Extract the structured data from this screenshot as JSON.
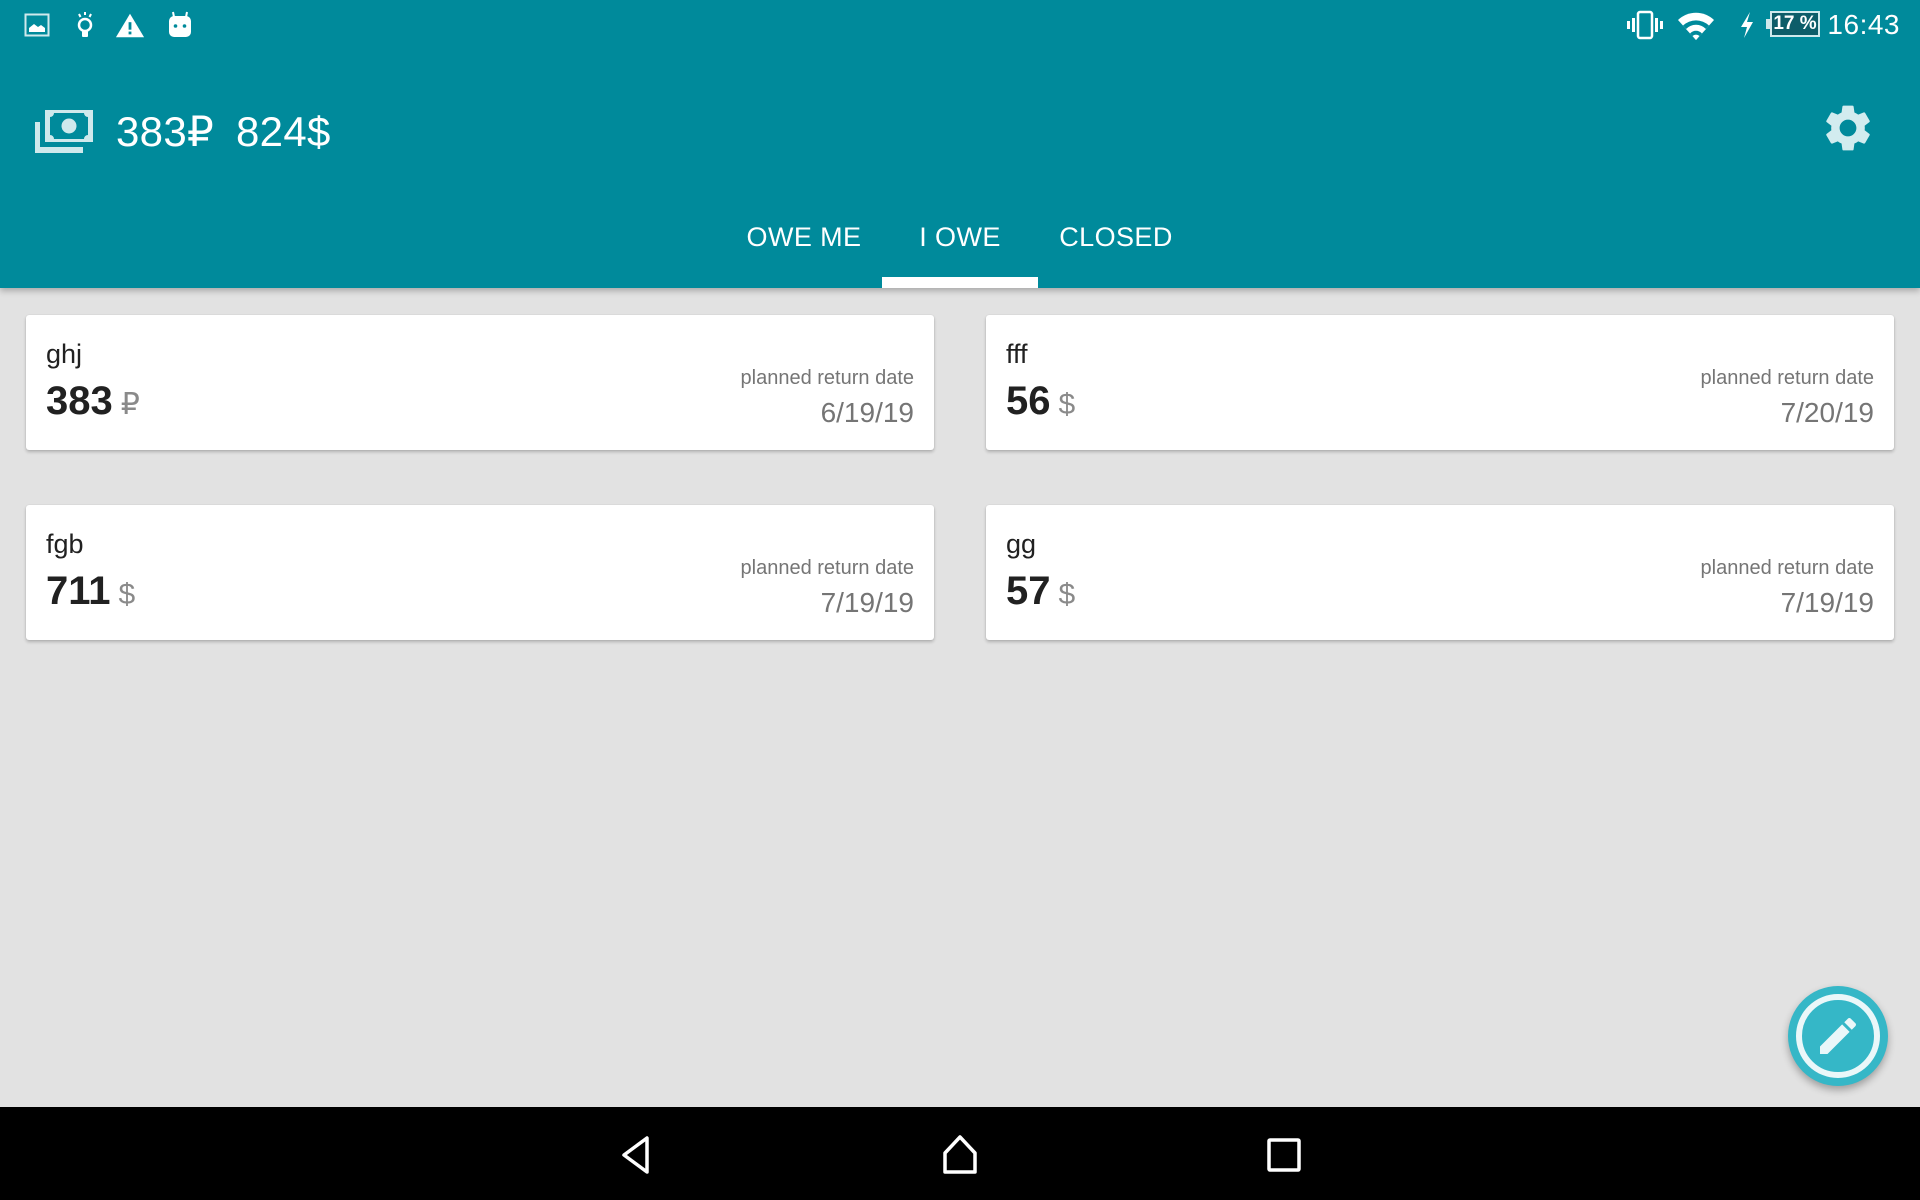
{
  "status_bar": {
    "left_icons": [
      "image-icon",
      "lightbulb-icon",
      "warning-icon",
      "android-icon"
    ],
    "right_icons": [
      "vibrate-icon",
      "wifi-icon",
      "charging-icon"
    ],
    "battery_percent": "17 %",
    "time": "16:43"
  },
  "app_bar": {
    "icon": "money-icon",
    "totals": [
      {
        "amount": "383",
        "currency": "₽"
      },
      {
        "amount": "824",
        "currency": "$"
      }
    ],
    "settings_icon": "gear-icon"
  },
  "tabs": [
    {
      "label": "OWE ME",
      "selected": false
    },
    {
      "label": "I OWE",
      "selected": true
    },
    {
      "label": "CLOSED",
      "selected": false
    }
  ],
  "debts": [
    {
      "name": "ghj",
      "amount": "383",
      "currency": "₽",
      "date_label": "planned return date",
      "date": "6/19/19"
    },
    {
      "name": "fff",
      "amount": "56",
      "currency": "$",
      "date_label": "planned return date",
      "date": "7/20/19"
    },
    {
      "name": "fgb",
      "amount": "711",
      "currency": "$",
      "date_label": "planned return date",
      "date": "7/19/19"
    },
    {
      "name": "gg",
      "amount": "57",
      "currency": "$",
      "date_label": "planned return date",
      "date": "7/19/19"
    }
  ],
  "fab": {
    "icon": "pencil-icon"
  },
  "nav_bar": {
    "buttons": [
      "back-icon",
      "home-icon",
      "recents-icon"
    ]
  },
  "colors": {
    "primary": "#008a9b",
    "accent": "#35b7c7",
    "background": "#e2e2e2",
    "secondary_text": "#757575"
  }
}
